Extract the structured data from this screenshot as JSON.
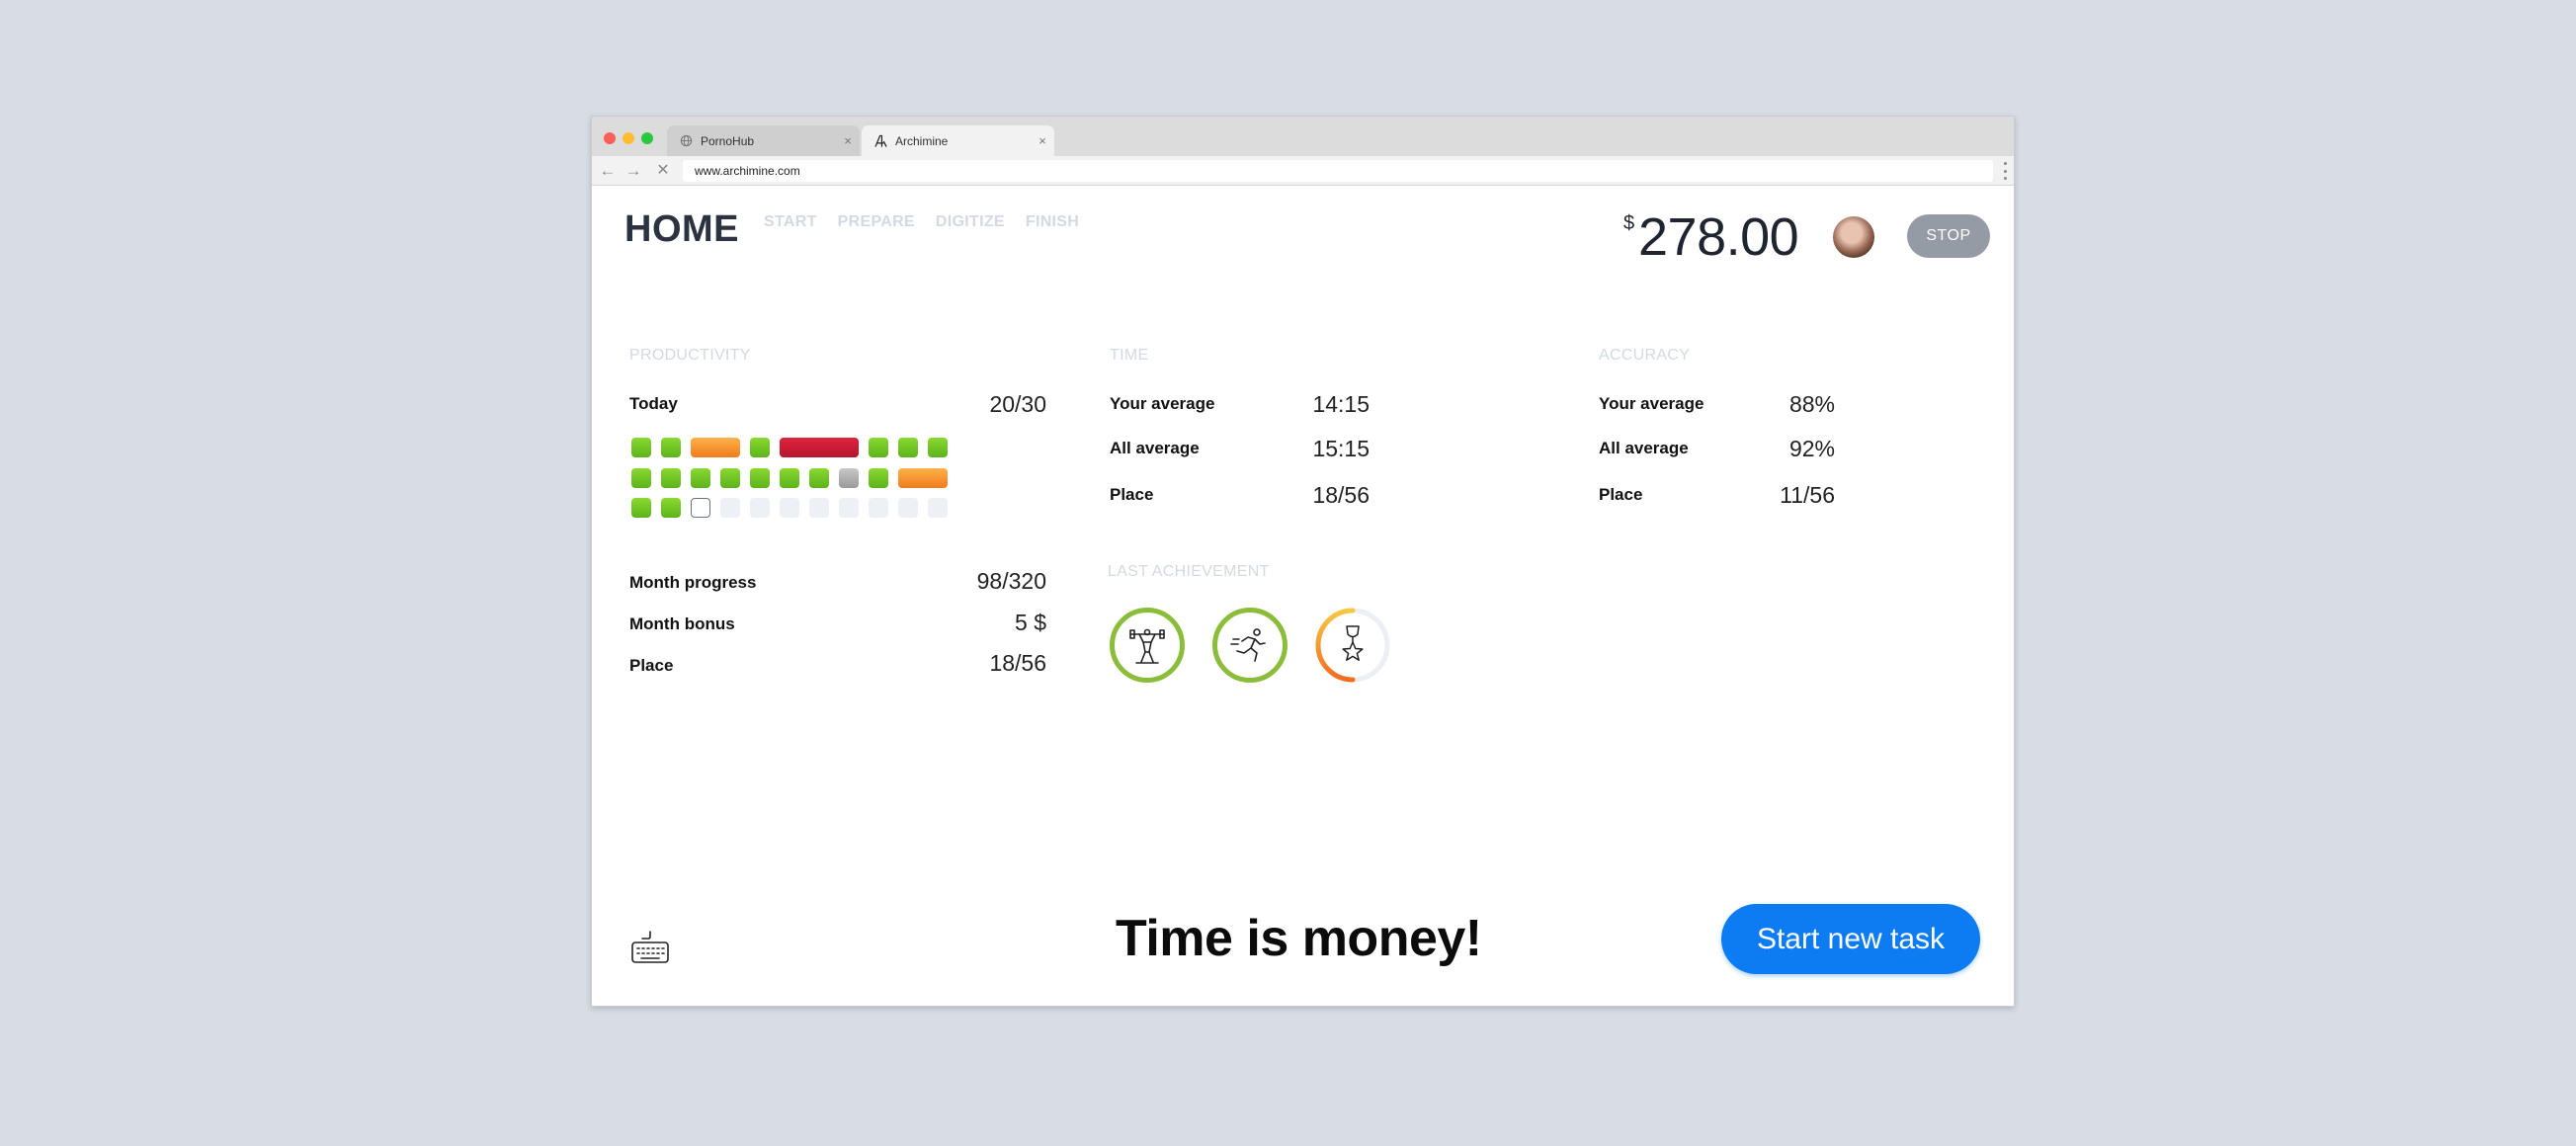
{
  "browser": {
    "tabs": [
      {
        "label": "PornoHub",
        "icon": "globe-icon"
      },
      {
        "label": "Archimine",
        "icon": "archimine-logo-icon"
      }
    ],
    "url": "www.archimine.com"
  },
  "header": {
    "title": "HOME",
    "nav": [
      "START",
      "PREPARE",
      "DIGITIZE",
      "FINISH"
    ],
    "currency": "$",
    "balance": "278.00",
    "stop_label": "STOP"
  },
  "productivity": {
    "title": "PRODUCTIVITY",
    "today_label": "Today",
    "today_value": "20/30",
    "grid_rows": [
      [
        "green",
        "green",
        "orange-wide",
        "green",
        "red-wide",
        "green",
        "green",
        "green"
      ],
      [
        "green",
        "green",
        "green",
        "green",
        "green",
        "green",
        "green",
        "gray",
        "green",
        "orange-wide"
      ],
      [
        "green",
        "green",
        "current",
        "empty",
        "empty",
        "empty",
        "empty",
        "empty",
        "empty",
        "empty",
        "empty"
      ]
    ],
    "month_progress_label": "Month progress",
    "month_progress_value": "98/320",
    "month_bonus_label": "Month bonus",
    "month_bonus_value": "5 $",
    "place_label": "Place",
    "place_value": "18/56"
  },
  "time": {
    "title": "TIME",
    "your_average_label": "Your average",
    "your_average_value": "14:15",
    "all_average_label": "All average",
    "all_average_value": "15:15",
    "place_label": "Place",
    "place_value": "18/56"
  },
  "accuracy": {
    "title": "ACCURACY",
    "your_average_label": "Your average",
    "your_average_value": "88%",
    "all_average_label": "All average",
    "all_average_value": "92%",
    "place_label": "Place",
    "place_value": "11/56"
  },
  "achievements": {
    "title": "LAST ACHIEVEMENT",
    "badges": [
      {
        "icon": "weightlifter-icon",
        "progress": 1.0
      },
      {
        "icon": "runner-icon",
        "progress": 1.0
      },
      {
        "icon": "trophy-star-icon",
        "progress": 0.5
      }
    ]
  },
  "footer": {
    "tagline": "Time is money!",
    "cta_label": "Start new task",
    "keyboard_icon": "keyboard-icon"
  },
  "colors": {
    "accent": "#0d7cf2",
    "success": "#6cc024",
    "warning": "#f59a2e",
    "danger": "#cc1c35"
  }
}
